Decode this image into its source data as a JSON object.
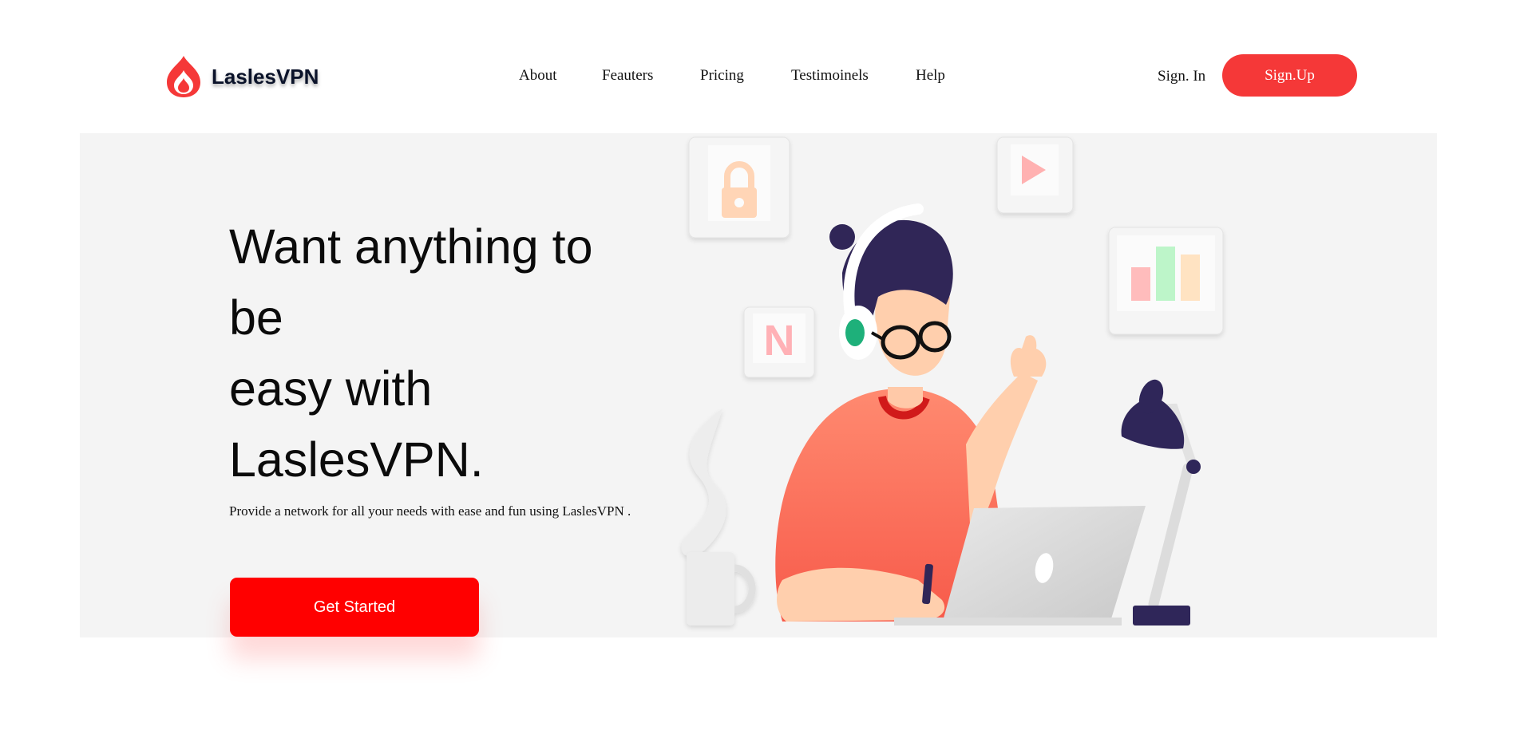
{
  "brand": {
    "name": "LaslesVPN",
    "icon": "flame-logo-icon",
    "accent": "#f53838"
  },
  "nav": {
    "items": [
      {
        "label": "About"
      },
      {
        "label": "Feauters"
      },
      {
        "label": "Pricing"
      },
      {
        "label": "Testimoinels"
      },
      {
        "label": "Help"
      }
    ]
  },
  "auth": {
    "sign_in": "Sign. In",
    "sign_up": "Sign.Up"
  },
  "hero": {
    "title_lines": [
      "Want anything to",
      "be",
      "easy with",
      "LaslesVPN."
    ],
    "description": "Provide a network for all your needs with ease and fun using LaslesVPN .",
    "cta_label": "Get Started",
    "cta_color": "#ff0000",
    "background": "#f4f4f4",
    "illustration": {
      "tiles": [
        "lock-icon",
        "play-icon",
        "netflix-n-icon",
        "bar-chart-icon"
      ],
      "tile_n_letter": "N",
      "elements": [
        "person-with-headphones",
        "laptop-icon",
        "desk-lamp-icon",
        "coffee-mug-icon",
        "steam-icon"
      ]
    }
  }
}
